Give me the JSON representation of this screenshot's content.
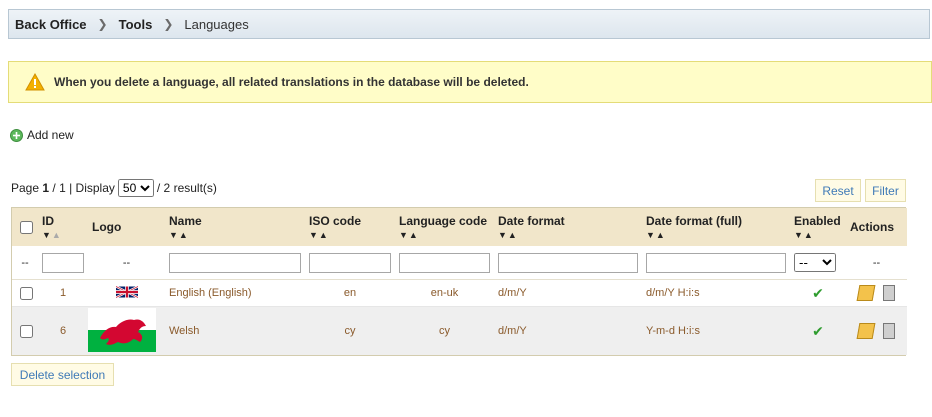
{
  "breadcrumb": {
    "item1": "Back Office",
    "item2": "Tools",
    "item3": "Languages"
  },
  "warning": {
    "text": "When you delete a language, all related translations in the database will be deleted."
  },
  "add_new": {
    "label": "Add new"
  },
  "pager": {
    "page_label": "Page",
    "page_current": "1",
    "page_total": "/ 1",
    "display_label": "| Display",
    "per_page": "50",
    "results": "/ 2 result(s)"
  },
  "buttons": {
    "reset": "Reset",
    "filter": "Filter",
    "delete_selection": "Delete selection"
  },
  "columns": {
    "id": "ID",
    "logo": "Logo",
    "name": "Name",
    "iso": "ISO code",
    "lang": "Language code",
    "date": "Date format",
    "date_full": "Date format (full)",
    "enabled": "Enabled",
    "actions": "Actions"
  },
  "filter": {
    "dash": "--",
    "enabled_select": "--"
  },
  "rows": [
    {
      "id": "1",
      "name": "English (English)",
      "iso": "en",
      "lang": "en-uk",
      "date": "d/m/Y",
      "date_full": "d/m/Y H:i:s"
    },
    {
      "id": "6",
      "name": "Welsh",
      "iso": "cy",
      "lang": "cy",
      "date": "d/m/Y",
      "date_full": "Y-m-d H:i:s"
    }
  ],
  "colors": {
    "link_blue": "#3f7ab7",
    "header_bg": "#f1e6ca",
    "warning_bg": "#fffdc8"
  }
}
